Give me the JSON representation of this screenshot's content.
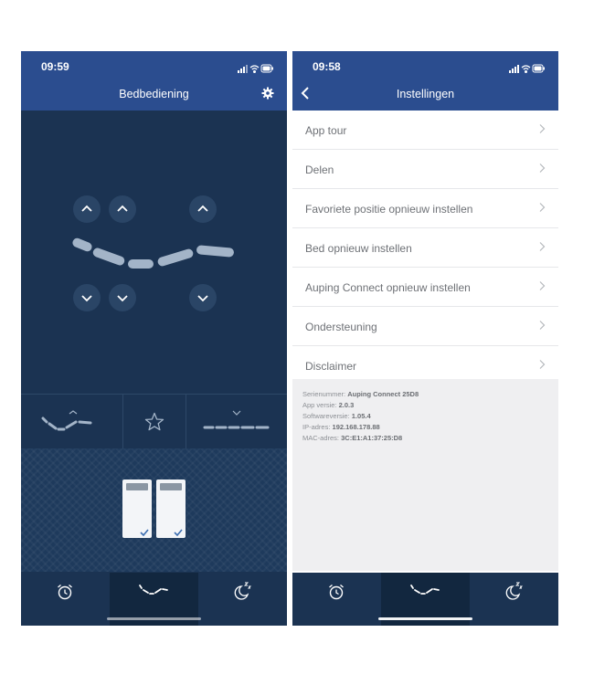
{
  "left": {
    "status_time": "09:59",
    "title": "Bedbediening",
    "icons": [
      "signal-icon",
      "wifi-icon",
      "battery-icon",
      "gear-icon",
      "chevron-up-icon",
      "chevron-down-icon",
      "lying-position-icon",
      "star-icon",
      "flat-position-icon",
      "check-icon",
      "alarm-clock-icon",
      "bed-position-icon",
      "sleep-moon-icon"
    ],
    "active_tab": "bed-position"
  },
  "right": {
    "status_time": "09:58",
    "title": "Instellingen",
    "menu": [
      {
        "label": "App tour"
      },
      {
        "label": "Delen"
      },
      {
        "label": "Favoriete positie opnieuw instellen"
      },
      {
        "label": "Bed opnieuw instellen"
      },
      {
        "label": "Auping Connect opnieuw instellen"
      },
      {
        "label": "Ondersteuning"
      },
      {
        "label": "Disclaimer"
      }
    ],
    "info": [
      {
        "label": "Serienummer:",
        "value": "Auping Connect 25D8"
      },
      {
        "label": "App versie:",
        "value": "2.0.3"
      },
      {
        "label": "Softwareversie:",
        "value": "1.05.4"
      },
      {
        "label": "IP-adres:",
        "value": "192.168.178.88"
      },
      {
        "label": "MAC-adres:",
        "value": "3C:E1:A1:37:25:D8"
      }
    ],
    "active_tab": "bed-position"
  },
  "colors": {
    "header": "#2b4d8f",
    "panel_dark": "#1b3352",
    "button": "#2a4566",
    "segment": "#a3b4c8",
    "check": "#3b6db0"
  }
}
